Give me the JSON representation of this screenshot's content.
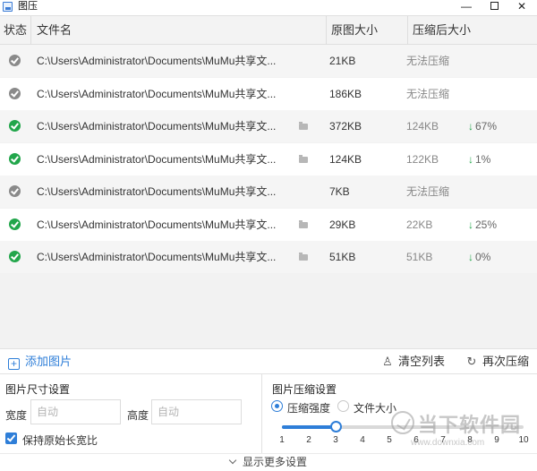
{
  "window": {
    "title": "图压",
    "min_glyph": "—",
    "close_glyph": "✕"
  },
  "table": {
    "headers": {
      "status": "状态",
      "name": "文件名",
      "original_size": "原图大小",
      "compressed_size": "压缩后大小"
    },
    "rows": [
      {
        "status": "gray",
        "name": "C:\\Users\\Administrator\\Documents\\MuMu共享文...",
        "folder": false,
        "original": "21KB",
        "compressed": "无法压缩",
        "ratio": ""
      },
      {
        "status": "gray",
        "name": "C:\\Users\\Administrator\\Documents\\MuMu共享文...",
        "folder": false,
        "original": "186KB",
        "compressed": "无法压缩",
        "ratio": ""
      },
      {
        "status": "green",
        "name": "C:\\Users\\Administrator\\Documents\\MuMu共享文...",
        "folder": true,
        "original": "372KB",
        "compressed": "124KB",
        "ratio": "67%"
      },
      {
        "status": "green",
        "name": "C:\\Users\\Administrator\\Documents\\MuMu共享文...",
        "folder": true,
        "original": "124KB",
        "compressed": "122KB",
        "ratio": "1%"
      },
      {
        "status": "gray",
        "name": "C:\\Users\\Administrator\\Documents\\MuMu共享文...",
        "folder": false,
        "original": "7KB",
        "compressed": "无法压缩",
        "ratio": ""
      },
      {
        "status": "green",
        "name": "C:\\Users\\Administrator\\Documents\\MuMu共享文...",
        "folder": true,
        "original": "29KB",
        "compressed": "22KB",
        "ratio": "25%"
      },
      {
        "status": "green",
        "name": "C:\\Users\\Administrator\\Documents\\MuMu共享文...",
        "folder": true,
        "original": "51KB",
        "compressed": "51KB",
        "ratio": "0%"
      }
    ]
  },
  "actions": {
    "add_image": "添加图片",
    "clear_list": "清空列表",
    "recompress": "再次压缩"
  },
  "size_settings": {
    "title": "图片尺寸设置",
    "width_label": "宽度",
    "width_placeholder": "自动",
    "height_label": "高度",
    "height_placeholder": "自动",
    "keep_ratio_label": "保持原始长宽比",
    "keep_ratio_checked": true
  },
  "compress_settings": {
    "title": "图片压缩设置",
    "mode_strength_label": "压缩强度",
    "mode_size_label": "文件大小",
    "selected_mode": "strength",
    "slider_value": 3,
    "slider_ticks": [
      "1",
      "2",
      "3",
      "4",
      "5",
      "6",
      "7",
      "8",
      "9",
      "10"
    ]
  },
  "footer": {
    "more_settings": "显示更多设置"
  },
  "watermark": {
    "text": "当下软件园",
    "url": "www.downxia.com"
  },
  "colors": {
    "accent": "#2e7ed8",
    "success": "#22a64b",
    "disabled": "#8a8a8a"
  }
}
